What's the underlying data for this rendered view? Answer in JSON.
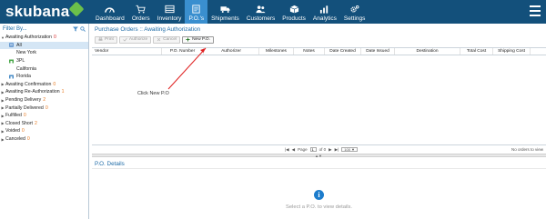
{
  "brand": {
    "name": "skubana"
  },
  "nav": [
    {
      "label": "Dashboard",
      "icon": "dashboard-icon"
    },
    {
      "label": "Orders",
      "icon": "cart-icon"
    },
    {
      "label": "Inventory",
      "icon": "inventory-icon"
    },
    {
      "label": "P.O.'s",
      "icon": "purchase-order-icon",
      "active": true
    },
    {
      "label": "Shipments",
      "icon": "truck-icon"
    },
    {
      "label": "Customers",
      "icon": "customers-icon"
    },
    {
      "label": "Products",
      "icon": "products-icon"
    },
    {
      "label": "Analytics",
      "icon": "analytics-icon"
    },
    {
      "label": "Settings",
      "icon": "gear-icon"
    }
  ],
  "sidebar": {
    "title": "Filter By...",
    "tree": [
      {
        "label": "Awaiting Authorization",
        "count": "0",
        "expanded": true
      },
      {
        "label": "All",
        "selected": true,
        "icon": "list-icon"
      },
      {
        "label": "New York"
      },
      {
        "label": "3PL",
        "icon": "warehouse-icon"
      },
      {
        "label": "California"
      },
      {
        "label": "Florida",
        "icon": "warehouse-icon"
      },
      {
        "label": "Awaiting Confirmation",
        "count": "0"
      },
      {
        "label": "Awaiting Re-Authorization",
        "count": "1"
      },
      {
        "label": "Pending Delivery",
        "count": "2"
      },
      {
        "label": "Partially Delivered",
        "count": "0"
      },
      {
        "label": "Fulfilled",
        "count": "0"
      },
      {
        "label": "Closed Short",
        "count": "2"
      },
      {
        "label": "Voided",
        "count": "0"
      },
      {
        "label": "Canceled",
        "count": "0"
      }
    ]
  },
  "main": {
    "breadcrumb": "Purchase Orders :: Awaiting Authorization",
    "toolbar": {
      "print": "Print",
      "authorize": "Authorize",
      "cancel": "Cancel",
      "new_po": "New P.O."
    },
    "columns": [
      "Vendor",
      "P.O. Number",
      "Authorizer",
      "Milestones",
      "Notes",
      "Date Created",
      "Date Issued",
      "Destination",
      "Total Cost",
      "Shipping Cost"
    ],
    "pager": {
      "page_label": "Page",
      "page": "1",
      "of": "of 0",
      "page_size": "100",
      "status": "No orders to view"
    },
    "details_title": "P.O. Details",
    "empty_text": "Select a P.O. to view details."
  },
  "annotation": {
    "text": "Click New P.O"
  },
  "colors": {
    "nav_bg": "#13507b",
    "nav_active": "#3a8fcf",
    "link": "#1c6aa6",
    "arrow": "#e02020"
  }
}
